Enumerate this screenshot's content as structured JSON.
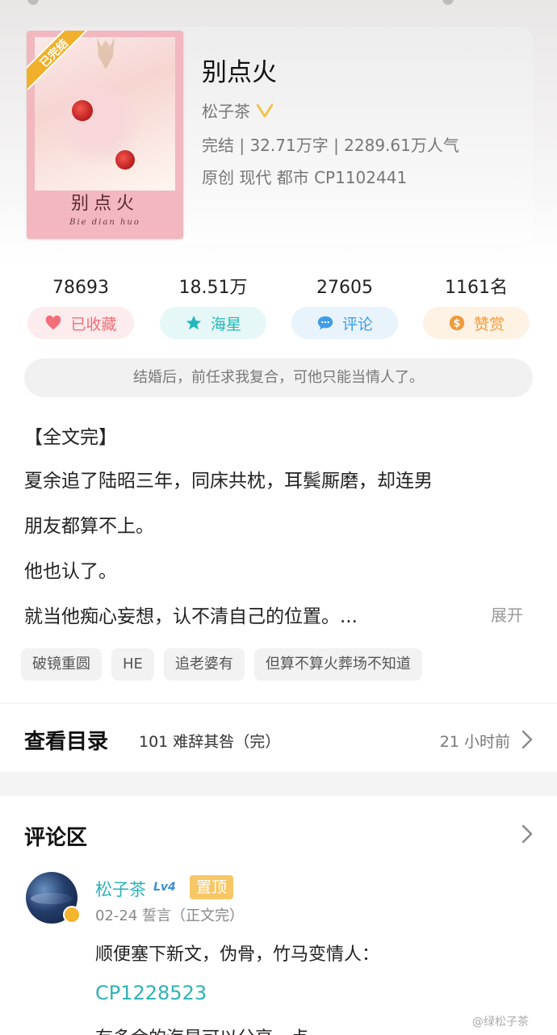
{
  "book": {
    "badge": "已完结",
    "cover_title": "别点火",
    "cover_subtitle": "Bie dian huo",
    "title": "别点火",
    "author": "松子茶",
    "meta_line1": "完结 | 32.71万字 | 2289.61万人气",
    "meta_line2": "原创 现代 都市 CP1102441"
  },
  "stats": [
    {
      "value": "78693",
      "label": "已收藏",
      "icon": "heart-icon",
      "color": "#f26e78",
      "bg": "#fdeced"
    },
    {
      "value": "18.51万",
      "label": "海星",
      "icon": "star-icon",
      "color": "#22b7b9",
      "bg": "#e6f7f7"
    },
    {
      "value": "27605",
      "label": "评论",
      "icon": "comment-icon",
      "color": "#3f9de8",
      "bg": "#e9f3fc"
    },
    {
      "value": "1161名",
      "label": "赞赏",
      "icon": "coin-icon",
      "color": "#f09a3c",
      "bg": "#fdf2e4"
    }
  ],
  "slogan": "结婚后，前任求我复合，可他只能当情人了。",
  "description": {
    "line1": "【全文完】",
    "line2": "夏余追了陆昭三年，同床共枕，耳鬓厮磨，却连男",
    "line3": "朋友都算不上。",
    "line4": "他也认了。",
    "line5": "就当他痴心妄想，认不清自己的位置。...",
    "expand": "展开"
  },
  "tags": [
    "破镜重圆",
    "HE",
    "追老婆有",
    "但算不算火葬场不知道"
  ],
  "toc": {
    "title": "查看目录",
    "latest": "101 难辞其咎（完）",
    "time": "21 小时前"
  },
  "comments": {
    "title": "评论区",
    "item": {
      "name": "松子茶",
      "level": "Lv4",
      "pinned": "置顶",
      "date": "02-24  誓言（正文完）",
      "body1": "顺便塞下新文，伪骨，竹马变情人：",
      "link": "CP1228523",
      "body2": "有多余的海星可以分享一点"
    }
  },
  "watermark": "@绿松子茶"
}
